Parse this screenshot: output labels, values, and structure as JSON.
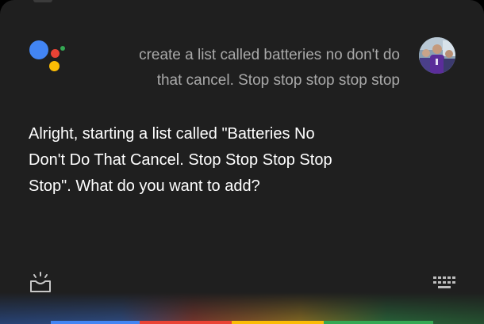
{
  "colors": {
    "google_blue": "#4285F4",
    "google_red": "#EA4335",
    "google_yellow": "#FBBC05",
    "google_green": "#34A853"
  },
  "conversation": {
    "user_query_line1": "create a list called batteries no don't do",
    "user_query_line2": "that cancel. Stop stop stop stop stop",
    "assistant_line1": "Alright, starting a list called \"Batteries No",
    "assistant_line2": "Don't Do That Cancel. Stop Stop Stop Stop",
    "assistant_line3": "Stop\". What do you want to add?"
  },
  "icons": {
    "assistant": "google-assistant-icon",
    "avatar": "user-avatar",
    "explore": "explore-inbox-icon",
    "keyboard": "keyboard-icon"
  }
}
